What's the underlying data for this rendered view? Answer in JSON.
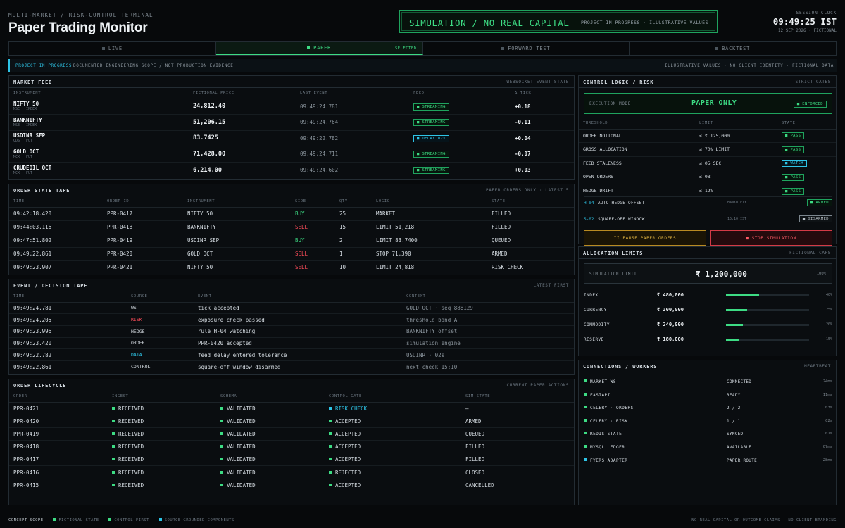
{
  "header": {
    "kicker": "MULTI-MARKET / RISK-CONTROL TERMINAL",
    "title": "Paper Trading Monitor",
    "banner_main": "SIMULATION / NO REAL CAPITAL",
    "banner_sub": "PROJECT IN PROGRESS · ILLUSTRATIVE VALUES",
    "clock_label": "SESSION CLOCK",
    "clock_time": "09:49:25 IST",
    "clock_date": "12 SEP 2026 · FICTIONAL"
  },
  "tabs": [
    {
      "label": "LIVE"
    },
    {
      "label": "PAPER",
      "tag": "SELECTED"
    },
    {
      "label": "FORWARD TEST"
    },
    {
      "label": "BACKTEST"
    }
  ],
  "notice": {
    "status": "PROJECT IN PROGRESS",
    "scope": "DOCUMENTED ENGINEERING SCOPE / NOT PRODUCTION EVIDENCE",
    "right": "ILLUSTRATIVE VALUES · NO CLIENT IDENTITY · FICTIONAL DATA"
  },
  "market_feed": {
    "title": "MARKET FEED",
    "right": "WEBSOCKET EVENT STATE",
    "columns": [
      "INSTRUMENT",
      "FICTIONAL PRICE",
      "LAST EVENT",
      "FEED",
      "Δ TICK"
    ],
    "rows": [
      {
        "name": "NIFTY 50",
        "sub": "NSE · INDEX",
        "price": "24,812.40",
        "time": "09:49:24.781",
        "feed": "STREAMING",
        "feed_color": "green",
        "delta": "+0.18"
      },
      {
        "name": "BANKNIFTY",
        "sub": "NSE · INDEX",
        "price": "51,206.15",
        "time": "09:49:24.764",
        "feed": "STREAMING",
        "feed_color": "green",
        "delta": "-0.11"
      },
      {
        "name": "USDINR SEP",
        "sub": "CDS · FUT",
        "price": "83.7425",
        "time": "09:49:22.782",
        "feed": "DELAY 02s",
        "feed_color": "cyan",
        "delta": "+0.04"
      },
      {
        "name": "GOLD OCT",
        "sub": "MCX · FUT",
        "price": "71,428.00",
        "time": "09:49:24.711",
        "feed": "STREAMING",
        "feed_color": "green",
        "delta": "-0.07"
      },
      {
        "name": "CRUDEOIL OCT",
        "sub": "MCX · FUT",
        "price": "6,214.00",
        "time": "09:49:24.602",
        "feed": "STREAMING",
        "feed_color": "green",
        "delta": "+0.03"
      }
    ]
  },
  "order_tape": {
    "title": "ORDER STATE TAPE",
    "right": "PAPER ORDERS ONLY · LATEST 5",
    "columns": [
      "TIME",
      "ORDER ID",
      "INSTRUMENT",
      "SIDE",
      "QTY",
      "LOGIC",
      "STATE"
    ],
    "rows": [
      {
        "time": "09:42:18.420",
        "id": "PPR-0417",
        "inst": "NIFTY 50",
        "side": "BUY",
        "qty": "25",
        "logic": "MARKET",
        "state": "FILLED"
      },
      {
        "time": "09:44:03.116",
        "id": "PPR-0418",
        "inst": "BANKNIFTY",
        "side": "SELL",
        "qty": "15",
        "logic": "LIMIT 51,218",
        "state": "FILLED"
      },
      {
        "time": "09:47:51.802",
        "id": "PPR-0419",
        "inst": "USDINR SEP",
        "side": "BUY",
        "qty": "2",
        "logic": "LIMIT 83.7400",
        "state": "QUEUED"
      },
      {
        "time": "09:49:22.861",
        "id": "PPR-0420",
        "inst": "GOLD OCT",
        "side": "SELL",
        "qty": "1",
        "logic": "STOP 71,390",
        "state": "ARMED"
      },
      {
        "time": "09:49:23.907",
        "id": "PPR-0421",
        "inst": "NIFTY 50",
        "side": "SELL",
        "qty": "10",
        "logic": "LIMIT 24,818",
        "state": "RISK CHECK"
      }
    ]
  },
  "event_tape": {
    "title": "EVENT / DECISION TAPE",
    "right": "LATEST FIRST",
    "columns": [
      "TIME",
      "SOURCE",
      "EVENT",
      "CONTEXT"
    ],
    "rows": [
      {
        "time": "09:49:24.781",
        "source": "WS",
        "source_color": "default",
        "event": "tick accepted",
        "context": "GOLD OCT · seq 888129"
      },
      {
        "time": "09:49:24.205",
        "source": "RISK",
        "source_color": "red",
        "event": "exposure check passed",
        "context": "threshold band A"
      },
      {
        "time": "09:49:23.996",
        "source": "HEDGE",
        "source_color": "default",
        "event": "rule H-04 watching",
        "context": "BANKNIFTY offset"
      },
      {
        "time": "09:49:23.420",
        "source": "ORDER",
        "source_color": "default",
        "event": "PPR-0420 accepted",
        "context": "simulation engine"
      },
      {
        "time": "09:49:22.782",
        "source": "DATA",
        "source_color": "cyan",
        "event": "feed delay entered tolerance",
        "context": "USDINR · 02s"
      },
      {
        "time": "09:49:22.861",
        "source": "CONTROL",
        "source_color": "default",
        "event": "square-off window disarmed",
        "context": "next check 15:10"
      }
    ]
  },
  "lifecycle": {
    "title": "ORDER LIFECYCLE",
    "right": "CURRENT PAPER ACTIONS",
    "columns": [
      "ORDER",
      "INGEST",
      "SCHEMA",
      "CONTROL GATE",
      "SIM STATE"
    ],
    "rows": [
      {
        "order": "PPR-0421",
        "ingest": "RECEIVED",
        "schema": "VALIDATED",
        "gate": "RISK CHECK",
        "gate_color": "cyan",
        "sim": "—"
      },
      {
        "order": "PPR-0420",
        "ingest": "RECEIVED",
        "schema": "VALIDATED",
        "gate": "ACCEPTED",
        "gate_color": "green",
        "sim": "ARMED"
      },
      {
        "order": "PPR-0419",
        "ingest": "RECEIVED",
        "schema": "VALIDATED",
        "gate": "ACCEPTED",
        "gate_color": "green",
        "sim": "QUEUED"
      },
      {
        "order": "PPR-0418",
        "ingest": "RECEIVED",
        "schema": "VALIDATED",
        "gate": "ACCEPTED",
        "gate_color": "green",
        "sim": "FILLED"
      },
      {
        "order": "PPR-0417",
        "ingest": "RECEIVED",
        "schema": "VALIDATED",
        "gate": "ACCEPTED",
        "gate_color": "green",
        "sim": "FILLED"
      },
      {
        "order": "PPR-0416",
        "ingest": "RECEIVED",
        "schema": "VALIDATED",
        "gate": "REJECTED",
        "gate_color": "green",
        "sim": "CLOSED"
      },
      {
        "order": "PPR-0415",
        "ingest": "RECEIVED",
        "schema": "VALIDATED",
        "gate": "ACCEPTED",
        "gate_color": "green",
        "sim": "CANCELLED"
      }
    ]
  },
  "control": {
    "title": "CONTROL LOGIC / RISK",
    "right": "STRICT GATES",
    "exec_label": "EXECUTION MODE",
    "exec_value": "PAPER ONLY",
    "exec_badge": "ENFORCED",
    "columns": [
      "THRESHOLD",
      "LIMIT",
      "STATE"
    ],
    "rows": [
      {
        "name": "ORDER NOTIONAL",
        "limit": "≤ ₹ 125,000",
        "state": "PASS",
        "color": "green"
      },
      {
        "name": "GROSS ALLOCATION",
        "limit": "≤ 70% LIMIT",
        "state": "PASS",
        "color": "green"
      },
      {
        "name": "FEED STALENESS",
        "limit": "≤ 05 SEC",
        "state": "WATCH",
        "color": "cyan"
      },
      {
        "name": "OPEN ORDERS",
        "limit": "≤ 08",
        "state": "PASS",
        "color": "green"
      },
      {
        "name": "HEDGE DRIFT",
        "limit": "≤ 12%",
        "state": "PASS",
        "color": "green"
      }
    ],
    "gates": [
      {
        "id": "H-04",
        "name": "AUTO-HEDGE OFFSET",
        "mid": "BANKNIFTY",
        "state": "ARMED",
        "color": "green"
      },
      {
        "id": "S-02",
        "name": "SQUARE-OFF WINDOW",
        "mid": "15:10 IST",
        "state": "DISARMED",
        "color": "grey"
      }
    ],
    "pause_label": "II PAUSE PAPER ORDERS",
    "stop_label": "■ STOP SIMULATION"
  },
  "allocation": {
    "title": "ALLOCATION LIMITS",
    "right": "FICTIONAL CAPS",
    "sim_label": "SIMULATION LIMIT",
    "sim_value": "₹ 1,200,000",
    "sim_pct": "100%",
    "rows": [
      {
        "name": "INDEX",
        "value": "₹ 480,000",
        "pct": "40%",
        "fraction": 0.4
      },
      {
        "name": "CURRENCY",
        "value": "₹ 300,000",
        "pct": "25%",
        "fraction": 0.25
      },
      {
        "name": "COMMODITY",
        "value": "₹ 240,000",
        "pct": "20%",
        "fraction": 0.2
      },
      {
        "name": "RESERVE",
        "value": "₹ 180,000",
        "pct": "15%",
        "fraction": 0.15
      }
    ]
  },
  "connections": {
    "title": "CONNECTIONS / WORKERS",
    "right": "HEARTBEAT",
    "rows": [
      {
        "name": "MARKET WS",
        "status": "CONNECTED",
        "hb": "24ms",
        "color": "green"
      },
      {
        "name": "FASTAPI",
        "status": "READY",
        "hb": "11ms",
        "color": "green"
      },
      {
        "name": "CELERY · ORDERS",
        "status": "2 / 2",
        "hb": "03s",
        "color": "green"
      },
      {
        "name": "CELERY · RISK",
        "status": "1 / 1",
        "hb": "02s",
        "color": "green"
      },
      {
        "name": "REDIS STATE",
        "status": "SYNCED",
        "hb": "01s",
        "color": "green"
      },
      {
        "name": "MYSQL LEDGER",
        "status": "AVAILABLE",
        "hb": "07ms",
        "color": "green"
      },
      {
        "name": "FYERS ADAPTER",
        "status": "PAPER ROUTE",
        "hb": "28ms",
        "color": "cyan"
      }
    ]
  },
  "footer": {
    "scope": "CONCEPT SCOPE",
    "items": [
      "FICTIONAL STATE",
      "CONTROL-FIRST",
      "SOURCE-GROUNDED COMPONENTS"
    ],
    "right": "NO REAL-CAPITAL OR OUTCOME CLAIMS · NO CLIENT BRANDING"
  },
  "colors": {
    "accent_green": "#3ddc84",
    "alert_red": "#ff4d5a",
    "info_cyan": "#2ec4e6",
    "warn_amber": "#e0b341",
    "background": "#07090b"
  }
}
